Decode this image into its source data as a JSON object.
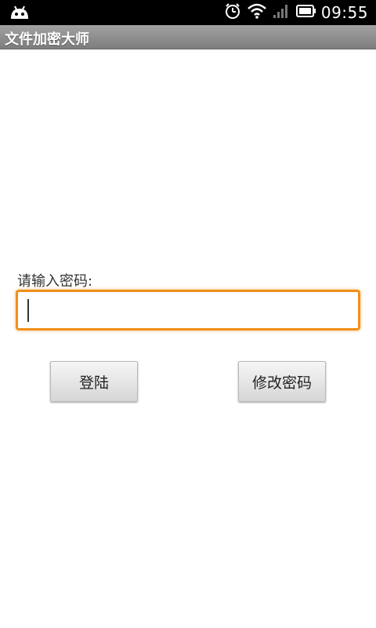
{
  "status_bar": {
    "time": "09:55",
    "icons": [
      "android-debug-icon",
      "alarm-icon",
      "wifi-icon",
      "signal-icon",
      "battery-icon"
    ]
  },
  "app": {
    "title": "文件加密大师"
  },
  "form": {
    "prompt_label": "请输入密码:",
    "password_value": "",
    "password_placeholder": ""
  },
  "buttons": {
    "login_label": "登陆",
    "change_password_label": "修改密码"
  },
  "colors": {
    "status_bar_bg": "#000000",
    "title_bar_bg": "#8a8a8a",
    "focus_border": "#f0901a",
    "button_bg": "#e4e4e4"
  }
}
